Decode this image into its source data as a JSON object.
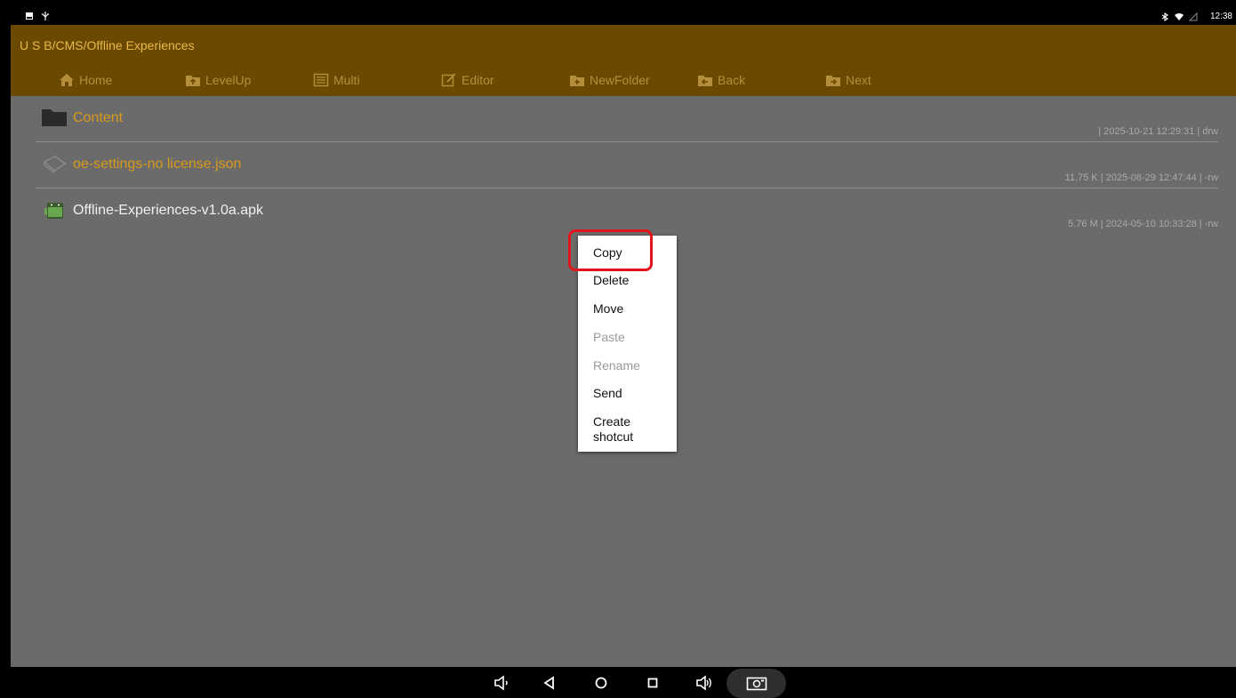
{
  "status_bar": {
    "time": "12:38",
    "left_icons": [
      "image-icon",
      "usb-icon"
    ],
    "right_icons": [
      "bluetooth-icon",
      "wifi-icon",
      "battery-icon"
    ]
  },
  "header": {
    "path": "U S B/CMS/Offline Experiences",
    "accent": "#6b4a00",
    "toolbar": [
      {
        "label": "Home",
        "icon": "home-icon"
      },
      {
        "label": "LevelUp",
        "icon": "folder-up-icon"
      },
      {
        "label": "Multi",
        "icon": "multi-select-icon"
      },
      {
        "label": "Editor",
        "icon": "edit-icon"
      },
      {
        "label": "NewFolder",
        "icon": "new-folder-icon"
      },
      {
        "label": "Back",
        "icon": "folder-back-icon"
      },
      {
        "label": "Next",
        "icon": "folder-next-icon"
      }
    ]
  },
  "files": [
    {
      "name": "Content",
      "meta": "| 2025-10-21 12:29:31 | drw",
      "icon": "folder-icon"
    },
    {
      "name": "oe-settings-no license.json",
      "meta": "11.75 K | 2025-08-29 12:47:44 | -rw",
      "icon": "file-icon"
    },
    {
      "name": "Offline-Experiences-v1.0a.apk",
      "meta": "5.76 M | 2024-05-10 10:33:28 | -rw",
      "icon": "android-apk-icon"
    }
  ],
  "context_menu": {
    "items": [
      {
        "label": "Copy",
        "enabled": true,
        "highlighted": true
      },
      {
        "label": "Delete",
        "enabled": true
      },
      {
        "label": "Move",
        "enabled": true
      },
      {
        "label": "Paste",
        "enabled": false
      },
      {
        "label": "Rename",
        "enabled": false
      },
      {
        "label": "Send",
        "enabled": true
      },
      {
        "label": "Create shotcut",
        "enabled": true
      }
    ]
  },
  "nav_bar": {
    "buttons": [
      "volume-down-icon",
      "back-icon",
      "home-circle-icon",
      "recents-icon",
      "volume-up-icon",
      "screenshot-icon"
    ]
  }
}
